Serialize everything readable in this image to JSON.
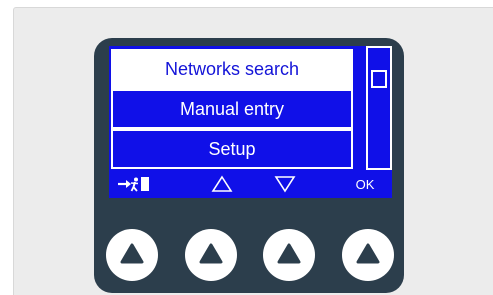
{
  "menu": {
    "items": [
      {
        "label": "Networks search",
        "selected": true
      },
      {
        "label": "Manual entry",
        "selected": false
      },
      {
        "label": "Setup",
        "selected": false
      }
    ]
  },
  "softkeys": {
    "ok_label": "OK",
    "exit_icon": "exit-icon",
    "up_icon": "triangle-up-outline-icon",
    "down_icon": "triangle-down-outline-icon"
  },
  "buttons": {
    "count": 4,
    "icon": "triangle-up-filled-icon"
  },
  "colors": {
    "screen_bg": "#1010e8",
    "device_body": "#2c3e4c",
    "selected_text": "#1414d8",
    "panel_bg": "#ececec"
  }
}
